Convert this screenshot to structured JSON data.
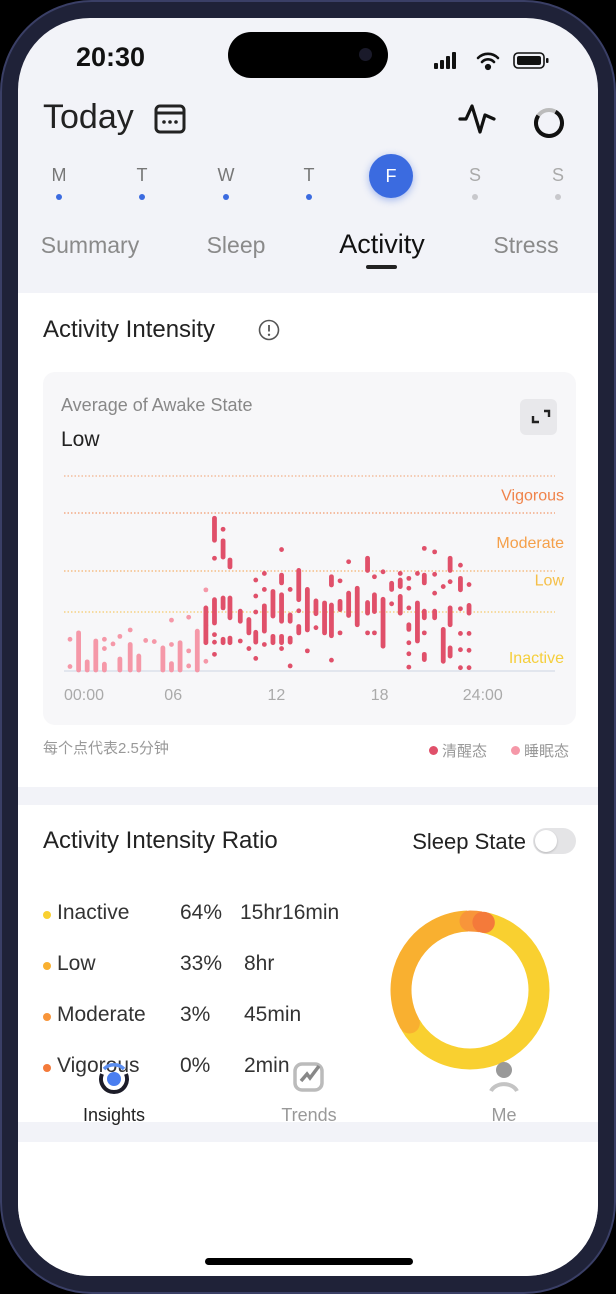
{
  "status_bar": {
    "time": "20:30"
  },
  "header": {
    "title": "Today",
    "days": [
      {
        "label": "M",
        "has_data": true
      },
      {
        "label": "T",
        "has_data": true
      },
      {
        "label": "W",
        "has_data": true
      },
      {
        "label": "T",
        "has_data": true
      },
      {
        "label": "F",
        "selected": true
      },
      {
        "label": "S",
        "has_data": false
      },
      {
        "label": "S",
        "has_data": false
      }
    ],
    "tabs": [
      {
        "label": "Summary"
      },
      {
        "label": "Sleep"
      },
      {
        "label": "Activity",
        "active": true
      },
      {
        "label": "Stress"
      }
    ]
  },
  "intensity_card": {
    "title": "Activity Intensity",
    "subtitle": "Average of Awake State",
    "value": "Low",
    "footnote": "每个点代表2.5分钟",
    "legend": [
      {
        "label": "清醒态",
        "color": "#e0506a"
      },
      {
        "label": "睡眠态",
        "color": "#f598a8"
      }
    ]
  },
  "chart_data": {
    "type": "scatter",
    "x_unit": "hour",
    "xlim": [
      0,
      24
    ],
    "x_ticks": [
      {
        "value": 0,
        "label": "00:00"
      },
      {
        "value": 6,
        "label": "06"
      },
      {
        "value": 12,
        "label": "12"
      },
      {
        "value": 18,
        "label": "18"
      },
      {
        "value": 24,
        "label": "24:00"
      }
    ],
    "levels": [
      {
        "name": "Inactive",
        "from": 0,
        "to": 1,
        "color": "#f5cf3c"
      },
      {
        "name": "Low",
        "from": 1,
        "to": 2,
        "color": "#f5bf48"
      },
      {
        "name": "Moderate",
        "from": 2,
        "to": 3,
        "color": "#f5a04a"
      },
      {
        "name": "Vigorous",
        "from": 3,
        "to": 4,
        "color": "#f0834a"
      }
    ],
    "series": [
      {
        "name": "睡眠态",
        "color": "#f598a8",
        "points": [
          [
            0.0,
            0.53,
            0.53
          ],
          [
            0.0,
            0.06,
            0.06
          ],
          [
            0.5,
            0.64,
            0
          ],
          [
            1.0,
            0.14,
            0
          ],
          [
            1.5,
            0.5,
            0
          ],
          [
            2.0,
            0.53,
            0.53
          ],
          [
            2.0,
            0.37,
            0.37
          ],
          [
            2.0,
            0.1,
            0
          ],
          [
            2.5,
            0.45,
            0.45
          ],
          [
            2.9,
            0.58,
            0.58
          ],
          [
            2.9,
            0.19,
            0
          ],
          [
            3.5,
            0.69,
            0.69
          ],
          [
            3.5,
            0.44,
            0
          ],
          [
            4.0,
            0.24,
            0
          ],
          [
            4.4,
            0.51,
            0.51
          ],
          [
            4.9,
            0.49,
            0.49
          ],
          [
            5.4,
            0.38,
            0
          ],
          [
            5.9,
            0.86,
            0.86
          ],
          [
            5.9,
            0.44,
            0.44
          ],
          [
            5.9,
            0.11,
            0
          ],
          [
            6.4,
            0.47,
            0
          ],
          [
            6.9,
            0.91,
            0.91
          ],
          [
            6.9,
            0.33,
            0.33
          ],
          [
            6.9,
            0.07,
            0.07
          ],
          [
            7.4,
            0.67,
            0
          ],
          [
            7.9,
            1.54,
            1.54
          ],
          [
            7.9,
            0.77,
            0.77
          ],
          [
            7.9,
            0.15,
            0.15
          ]
        ]
      },
      {
        "name": "清醒态",
        "color": "#e0506a",
        "points": [
          [
            7.9,
            1.1,
            0.47
          ],
          [
            8.4,
            2.91,
            2.53
          ],
          [
            8.4,
            2.22,
            2.22
          ],
          [
            8.4,
            1.3,
            0.81
          ],
          [
            8.4,
            0.61,
            0.61
          ],
          [
            8.4,
            0.48,
            0.48
          ],
          [
            8.4,
            0.27,
            0.27
          ],
          [
            8.9,
            2.72,
            2.72
          ],
          [
            8.9,
            2.52,
            2.24
          ],
          [
            8.9,
            1.34,
            1.1
          ],
          [
            8.9,
            0.53,
            0.47
          ],
          [
            9.3,
            2.19,
            2.07
          ],
          [
            9.3,
            1.34,
            0.9
          ],
          [
            9.3,
            0.55,
            0.47
          ],
          [
            9.9,
            1.02,
            0.84
          ],
          [
            9.9,
            0.5,
            0.5
          ],
          [
            10.4,
            0.87,
            0.64
          ],
          [
            10.4,
            0.37,
            0.37
          ],
          [
            10.8,
            1.78,
            1.78
          ],
          [
            10.8,
            1.39,
            1.39
          ],
          [
            10.8,
            1.0,
            1.0
          ],
          [
            10.8,
            0.65,
            0.48
          ],
          [
            10.8,
            0.2,
            0.2
          ],
          [
            11.3,
            1.94,
            1.94
          ],
          [
            11.3,
            1.55,
            1.55
          ],
          [
            11.3,
            1.15,
            0.67
          ],
          [
            11.3,
            0.44,
            0.44
          ],
          [
            11.8,
            1.5,
            0.93
          ],
          [
            11.8,
            0.58,
            0.47
          ],
          [
            12.3,
            2.37,
            2.37
          ],
          [
            12.3,
            1.9,
            1.71
          ],
          [
            12.3,
            1.42,
            0.84
          ],
          [
            12.3,
            0.58,
            0.47
          ],
          [
            12.3,
            0.37,
            0.37
          ],
          [
            12.8,
            1.55,
            1.55
          ],
          [
            12.8,
            0.95,
            0.84
          ],
          [
            12.8,
            0.55,
            0.48
          ],
          [
            12.8,
            0.07,
            0.07
          ],
          [
            13.3,
            2.01,
            1.3
          ],
          [
            13.3,
            1.03,
            1.03
          ],
          [
            13.3,
            0.75,
            0.64
          ],
          [
            13.8,
            1.55,
            0.69
          ],
          [
            13.8,
            0.33,
            0.33
          ],
          [
            14.3,
            1.27,
            0.97
          ],
          [
            14.3,
            0.73,
            0.73
          ],
          [
            14.8,
            1.22,
            0.64
          ],
          [
            15.2,
            1.86,
            1.66
          ],
          [
            15.2,
            1.17,
            0.59
          ],
          [
            15.2,
            0.17,
            0.17
          ],
          [
            15.7,
            1.76,
            1.76
          ],
          [
            15.7,
            1.26,
            1.06
          ],
          [
            15.7,
            0.64,
            0.64
          ],
          [
            16.2,
            2.16,
            2.16
          ],
          [
            16.2,
            1.46,
            0.94
          ],
          [
            16.7,
            1.58,
            0.78
          ],
          [
            17.3,
            2.22,
            2.01
          ],
          [
            17.3,
            1.23,
            0.98
          ],
          [
            17.3,
            0.64,
            0.64
          ],
          [
            17.7,
            1.86,
            1.86
          ],
          [
            17.7,
            1.42,
            1.01
          ],
          [
            17.7,
            0.64,
            0.64
          ],
          [
            18.2,
            1.98,
            1.98
          ],
          [
            18.2,
            1.31,
            0.41
          ],
          [
            18.7,
            1.7,
            1.55
          ],
          [
            18.7,
            1.2,
            1.2
          ],
          [
            19.2,
            1.94,
            1.94
          ],
          [
            19.2,
            1.78,
            1.62
          ],
          [
            19.2,
            1.38,
            0.98
          ],
          [
            19.7,
            1.82,
            1.82
          ],
          [
            19.7,
            1.58,
            1.58
          ],
          [
            19.7,
            1.1,
            1.1
          ],
          [
            19.7,
            0.78,
            0.7
          ],
          [
            19.7,
            0.47,
            0.47
          ],
          [
            19.7,
            0.28,
            0.28
          ],
          [
            19.7,
            0.05,
            0.05
          ],
          [
            20.2,
            1.94,
            1.94
          ],
          [
            20.2,
            1.22,
            0.5
          ],
          [
            20.6,
            2.39,
            2.39
          ],
          [
            20.6,
            1.9,
            1.71
          ],
          [
            20.6,
            1.02,
            0.9
          ],
          [
            20.6,
            0.64,
            0.64
          ],
          [
            20.6,
            0.27,
            0.18
          ],
          [
            21.2,
            2.33,
            2.33
          ],
          [
            21.2,
            1.92,
            1.92
          ],
          [
            21.2,
            1.46,
            1.46
          ],
          [
            21.2,
            1.02,
            0.9
          ],
          [
            21.7,
            1.62,
            1.62
          ],
          [
            21.7,
            0.7,
            0.15
          ],
          [
            22.1,
            2.22,
            2.01
          ],
          [
            22.1,
            1.74,
            1.74
          ],
          [
            22.1,
            1.1,
            0.78
          ],
          [
            22.1,
            0.38,
            0.24
          ],
          [
            22.7,
            2.1,
            2.1
          ],
          [
            22.7,
            1.82,
            1.54
          ],
          [
            22.7,
            1.08,
            1.08
          ],
          [
            22.7,
            0.63,
            0.63
          ],
          [
            22.7,
            0.35,
            0.35
          ],
          [
            22.7,
            0.04,
            0.04
          ],
          [
            23.2,
            1.67,
            1.67
          ],
          [
            23.2,
            1.16,
            0.98
          ],
          [
            23.2,
            0.63,
            0.63
          ],
          [
            23.2,
            0.34,
            0.34
          ],
          [
            23.2,
            0.04,
            0.04
          ]
        ]
      }
    ]
  },
  "ratio_card": {
    "title": "Activity Intensity Ratio",
    "toggle_label": "Sleep State",
    "toggle_on": false,
    "rows": [
      {
        "label": "Inactive",
        "percent": "64%",
        "duration": "15hr16min",
        "value": 64,
        "color": "#f9d030"
      },
      {
        "label": "Low",
        "percent": "33%",
        "duration": "8hr",
        "value": 33,
        "color": "#f9b030"
      },
      {
        "label": "Moderate",
        "percent": "3%",
        "duration": "45min",
        "value": 3,
        "color": "#f8953a"
      },
      {
        "label": "Vigorous",
        "percent": "0%",
        "duration": "2min",
        "value": 0.2,
        "color": "#f47a3a"
      }
    ]
  },
  "tabbar": {
    "items": [
      {
        "label": "Insights",
        "icon": "insights-icon",
        "active": true
      },
      {
        "label": "Trends",
        "icon": "trends-icon"
      },
      {
        "label": "Me",
        "icon": "person-icon"
      }
    ]
  },
  "colors": {
    "accent": "#3b6be0",
    "awake": "#e0506a",
    "sleep": "#f598a8"
  }
}
